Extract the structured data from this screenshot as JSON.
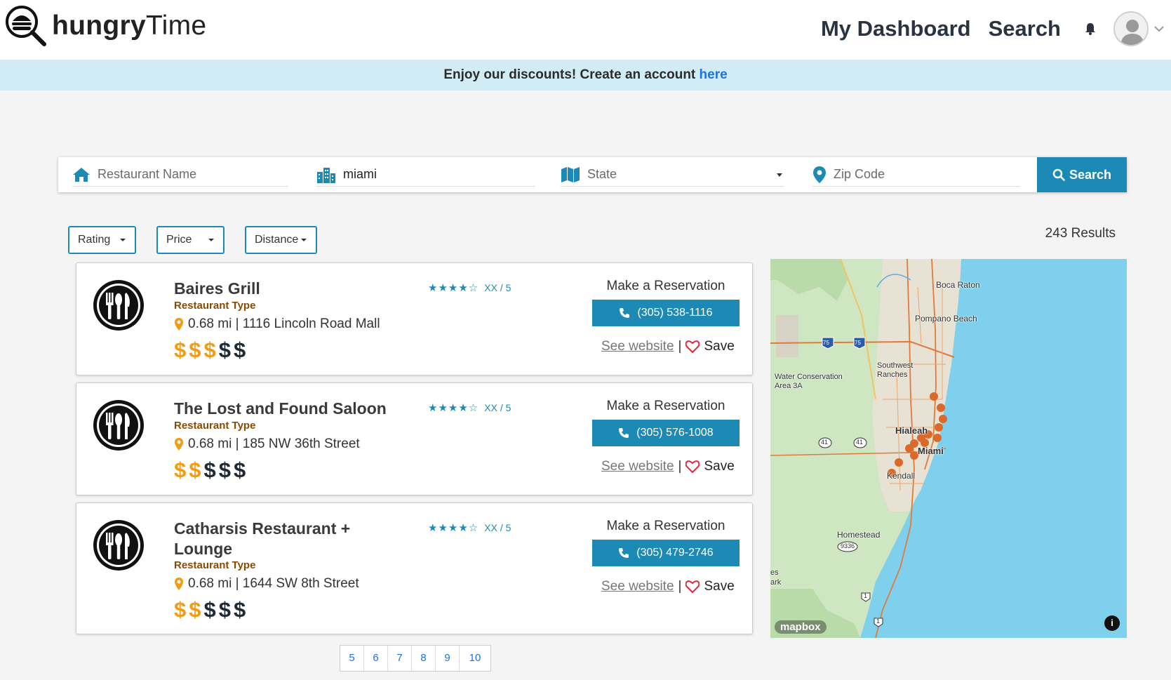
{
  "header": {
    "logo_bold": "hungry",
    "logo_light": "Time",
    "nav": [
      {
        "label": "My Dashboard"
      },
      {
        "label": "Search"
      }
    ]
  },
  "banner": {
    "text": "Enjoy our discounts! Create an account ",
    "link": "here"
  },
  "search": {
    "name_placeholder": "Restaurant Name",
    "city_value": "miami",
    "state_placeholder": "State",
    "zip_placeholder": "Zip Code",
    "button_label": "Search"
  },
  "filters": {
    "rating": "Rating",
    "price": "Price",
    "distance": "Distance"
  },
  "results_count": "243 Results",
  "restaurants": [
    {
      "name": "Baires Grill",
      "type": "Restaurant Type",
      "location": "0.68 mi | 1116 Lincoln Road Mall",
      "price_level": 3,
      "stars": "★★★★☆",
      "score": "XX / 5",
      "reserve_label": "Make a Reservation",
      "phone": "(305) 538-1116",
      "website_label": "See website",
      "save_label": "Save"
    },
    {
      "name": "The Lost and Found Saloon",
      "type": "Restaurant Type",
      "location": "0.68 mi | 185 NW 36th Street",
      "price_level": 2,
      "stars": "★★★★☆",
      "score": "XX / 5",
      "reserve_label": "Make a Reservation",
      "phone": "(305) 576-1008",
      "website_label": "See website",
      "save_label": "Save"
    },
    {
      "name": "Catharsis Restaurant + Lounge",
      "type": "Restaurant Type",
      "location": "0.68 mi | 1644 SW 8th Street",
      "price_level": 2,
      "stars": "★★★★☆",
      "score": "XX / 5",
      "reserve_label": "Make a Reservation",
      "phone": "(305) 479-2746",
      "website_label": "See website",
      "save_label": "Save"
    }
  ],
  "pagination": [
    "5",
    "6",
    "7",
    "8",
    "9",
    "10"
  ],
  "map": {
    "labels": [
      "Boca Raton",
      "Pompano Beach",
      "Southwest Ranches",
      "Water Conservation Area 3A",
      "Hialeah",
      "Miami",
      "Kendall",
      "Homestead",
      "es ark"
    ],
    "shields": [
      "75",
      "75",
      "41",
      "41",
      "9336",
      "1",
      "1"
    ],
    "attribution": "mapbox",
    "info": "i"
  }
}
